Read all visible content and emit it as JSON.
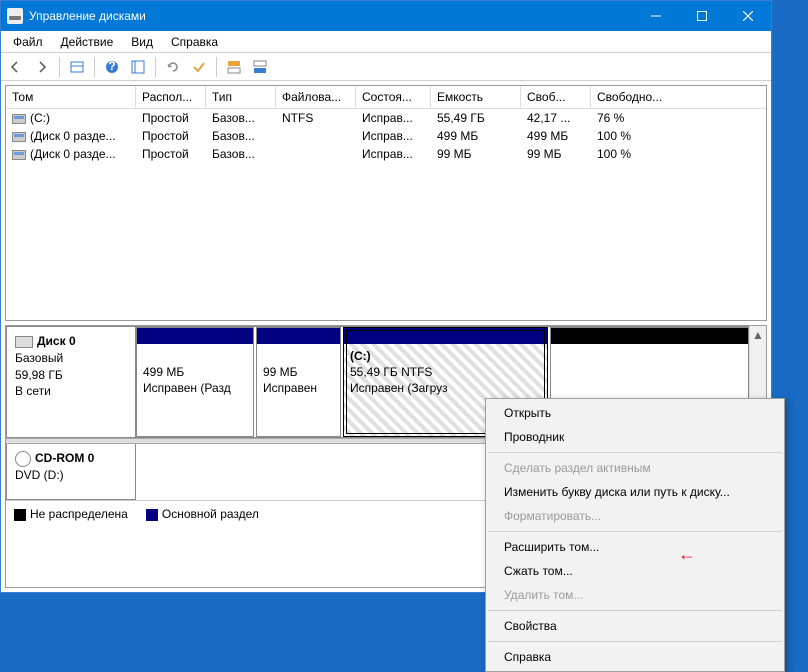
{
  "window": {
    "title": "Управление дисками"
  },
  "menu": {
    "file": "Файл",
    "action": "Действие",
    "view": "Вид",
    "help": "Справка"
  },
  "columns": {
    "volume": "Том",
    "layout": "Распол...",
    "type": "Тип",
    "fs": "Файлова...",
    "status": "Состоя...",
    "capacity": "Емкость",
    "free": "Своб...",
    "freepct": "Свободно..."
  },
  "volumes": [
    {
      "name": "(C:)",
      "layout": "Простой",
      "type": "Базов...",
      "fs": "NTFS",
      "status": "Исправ...",
      "capacity": "55,49 ГБ",
      "free": "42,17 ...",
      "freepct": "76 %"
    },
    {
      "name": "(Диск 0 разде...",
      "layout": "Простой",
      "type": "Базов...",
      "fs": "",
      "status": "Исправ...",
      "capacity": "499 МБ",
      "free": "499 МБ",
      "freepct": "100 %"
    },
    {
      "name": "(Диск 0 разде...",
      "layout": "Простой",
      "type": "Базов...",
      "fs": "",
      "status": "Исправ...",
      "capacity": "99 МБ",
      "free": "99 МБ",
      "freepct": "100 %"
    }
  ],
  "disk0": {
    "title": "Диск 0",
    "type": "Базовый",
    "size": "59,98 ГБ",
    "status": "В сети",
    "p1": {
      "size": "499 МБ",
      "status": "Исправен (Разд"
    },
    "p2": {
      "size": "99 МБ",
      "status": "Исправен"
    },
    "p3": {
      "label": "(C:)",
      "size": "55,49 ГБ NTFS",
      "status": "Исправен (Загруз"
    }
  },
  "cdrom": {
    "title": "CD-ROM 0",
    "sub": "DVD (D:)"
  },
  "legend": {
    "unalloc": "Не распределена",
    "primary": "Основной раздел"
  },
  "ctx": {
    "open": "Открыть",
    "explorer": "Проводник",
    "active": "Сделать раздел активным",
    "letter": "Изменить букву диска или путь к диску...",
    "format": "Форматировать...",
    "extend": "Расширить том...",
    "shrink": "Сжать том...",
    "delete": "Удалить том...",
    "props": "Свойства",
    "help": "Справка"
  }
}
